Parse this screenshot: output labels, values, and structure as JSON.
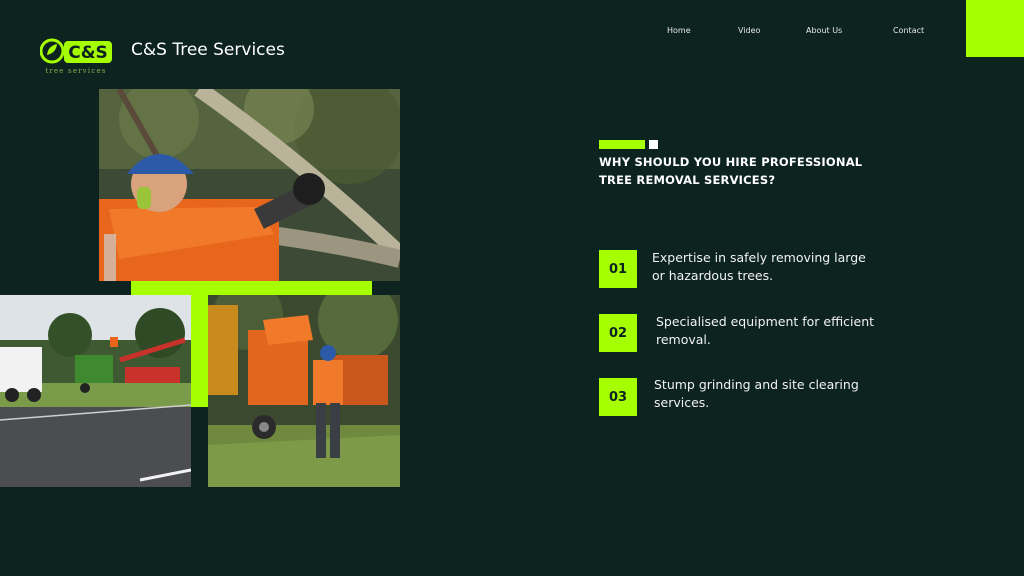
{
  "brand": {
    "logo_text": "C&S",
    "logo_tagline": "tree services",
    "name": "C&S Tree Services"
  },
  "nav": {
    "items": [
      "Home",
      "Video",
      "About Us",
      "Contact"
    ]
  },
  "colors": {
    "background": "#0c2320",
    "accent": "#a6ff00",
    "text": "#ffffff"
  },
  "main": {
    "heading": "WHY SHOULD YOU HIRE PROFESSIONAL TREE REMOVAL SERVICES?",
    "benefits": [
      {
        "number": "01",
        "text": "Expertise in safely removing large or hazardous trees."
      },
      {
        "number": "02",
        "text": "Specialised equipment for efficient removal."
      },
      {
        "number": "03",
        "text": "Stump grinding and site clearing services."
      }
    ]
  },
  "images": [
    {
      "name": "arborist-cutting-branch-photo"
    },
    {
      "name": "truck-and-cherry-picker-photo"
    },
    {
      "name": "wood-chipper-worker-photo"
    }
  ]
}
